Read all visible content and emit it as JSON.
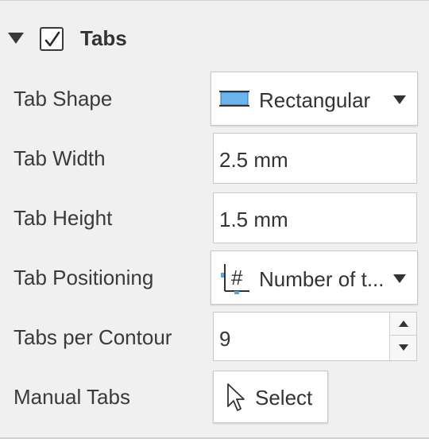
{
  "section": {
    "title": "Tabs",
    "enabled": true
  },
  "rows": {
    "tab_shape": {
      "label": "Tab Shape",
      "value": "Rectangular",
      "icon": "rectangular-tab-icon"
    },
    "tab_width": {
      "label": "Tab Width",
      "value": "2.5 mm"
    },
    "tab_height": {
      "label": "Tab Height",
      "value": "1.5 mm"
    },
    "tab_positioning": {
      "label": "Tab Positioning",
      "value": "Number of t...",
      "icon": "number-of-tabs-icon"
    },
    "tabs_per_contour": {
      "label": "Tabs per Contour",
      "value": "9"
    },
    "manual_tabs": {
      "label": "Manual Tabs",
      "button_label": "Select",
      "icon": "pointer-icon"
    }
  },
  "colors": {
    "accent_blue": "#5aa7e6",
    "text": "#3a3a3a",
    "panel_bg": "#f0f0f0"
  }
}
